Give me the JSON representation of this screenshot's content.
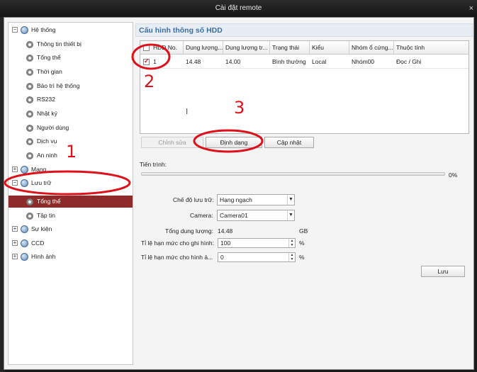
{
  "window": {
    "title": "Cài đặt remote",
    "close_glyph": "×"
  },
  "sidebar": {
    "items": [
      {
        "label": "Hệ thống",
        "level": 0,
        "expander": "−"
      },
      {
        "label": "Thông tin thiết bị",
        "level": 1
      },
      {
        "label": "Tổng thể",
        "level": 1
      },
      {
        "label": "Thời gian",
        "level": 1
      },
      {
        "label": "Bảo trì hệ thống",
        "level": 1
      },
      {
        "label": "RS232",
        "level": 1
      },
      {
        "label": "Nhật ký",
        "level": 1
      },
      {
        "label": "Người dùng",
        "level": 1
      },
      {
        "label": "Dịch vụ",
        "level": 1
      },
      {
        "label": "An ninh",
        "level": 1
      },
      {
        "label": "Mạng",
        "level": 0,
        "expander": "+"
      },
      {
        "label": "Lưu trữ",
        "level": 0,
        "expander": "−"
      },
      {
        "label": "Tổng thể",
        "level": 1,
        "selected": true
      },
      {
        "label": "Tập tin",
        "level": 1
      },
      {
        "label": "Sự kiện",
        "level": 0,
        "expander": "+"
      },
      {
        "label": "CCD",
        "level": 0,
        "expander": "+"
      },
      {
        "label": "Hình ảnh",
        "level": 0,
        "expander": "+"
      }
    ]
  },
  "main": {
    "section_title": "Cấu hình thông số HDD",
    "table": {
      "columns": [
        "HDD No.",
        "Dung lượng...",
        "Dung lượng tr...",
        "Trạng thái",
        "Kiểu",
        "Nhóm ổ cứng...",
        "Thuộc tính"
      ],
      "rows": [
        {
          "checked": true,
          "cells": [
            "1",
            "14.48",
            "14.00",
            "Bình thường",
            "Local",
            "Nhóm00",
            "Đọc / Ghi"
          ]
        }
      ]
    },
    "buttons": {
      "edit": "Chỉnh sửa",
      "format": "Định dạng",
      "update": "Cập nhật"
    },
    "progress": {
      "label": "Tiến trình:",
      "value_text": "0%",
      "value": 0
    },
    "form": {
      "storage_mode_label": "Chế độ lưu trữ:",
      "storage_mode_value": "Hạng ngạch",
      "camera_label": "Camera:",
      "camera_value": "Camera01",
      "total_capacity_label": "Tổng dung lượng:",
      "total_capacity_value": "14.48",
      "total_capacity_unit": "GB",
      "record_quota_label": "Tỉ lệ hạn mức cho ghi hình:",
      "record_quota_value": "100",
      "record_quota_unit": "%",
      "image_quota_label": "Tỉ lệ hạn mức cho hình ả...",
      "image_quota_value": "0",
      "image_quota_unit": "%",
      "save_label": "Lưu"
    }
  },
  "annotations": {
    "n1": "1",
    "n2": "2",
    "n3": "3",
    "color": "#e0101a"
  },
  "colors": {
    "selected_row": "#8f2a2a",
    "section_title": "#3b6ea5",
    "titlebar": "#1b1b1b"
  }
}
